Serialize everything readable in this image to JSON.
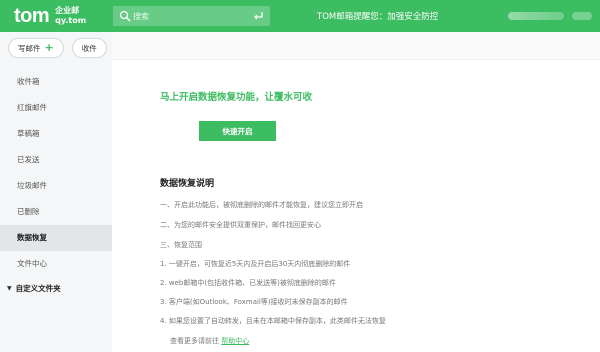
{
  "header": {
    "logo_main": "tom",
    "logo_sub_top": "企业邮",
    "logo_sub_bottom": "qy.tom",
    "search_placeholder": "搜索",
    "notice": "TOM邮箱提醒您：加强安全防控",
    "accent_color": "#3dbd62"
  },
  "toolbar": {
    "compose_label": "写邮件",
    "receive_label": "收件"
  },
  "sidebar": {
    "items": [
      {
        "label": "收件箱"
      },
      {
        "label": "红旗邮件"
      },
      {
        "label": "草稿箱"
      },
      {
        "label": "已发送"
      },
      {
        "label": "垃圾邮件"
      },
      {
        "label": "已删除"
      },
      {
        "label": "数据恢复"
      },
      {
        "label": "文件中心"
      }
    ],
    "active": "数据恢复",
    "custom_folders_label": "自定义文件夹"
  },
  "main": {
    "hero_title": "马上开启数据恢复功能，让覆水可收",
    "enable_button": "快速开启",
    "section_title": "数据恢复说明",
    "lines": [
      "一、开启此功能后，被彻底删除的邮件才能恢复，建议您立即开启",
      "二、为您的邮件安全提供双重保护，邮件找回更安心",
      "三、恢复范围",
      "1. 一键开启，可恢复近5天内及开启后30天内彻底删除的邮件",
      "2. web邮箱中(包括收件箱、已发送等)被彻底删除的邮件",
      "3. 客户端(如Outlook、Foxmail等)接收时未保存副本的邮件",
      "4. 如果您设置了自动转发，且未在本邮箱中保存副本，此类邮件无法恢复"
    ],
    "help_prefix": "查看更多请前往",
    "help_link": "帮助中心"
  },
  "icons": {
    "search": "search-icon",
    "enter": "enter-icon",
    "plus": "plus-icon",
    "triangle": "triangle-down-icon"
  }
}
